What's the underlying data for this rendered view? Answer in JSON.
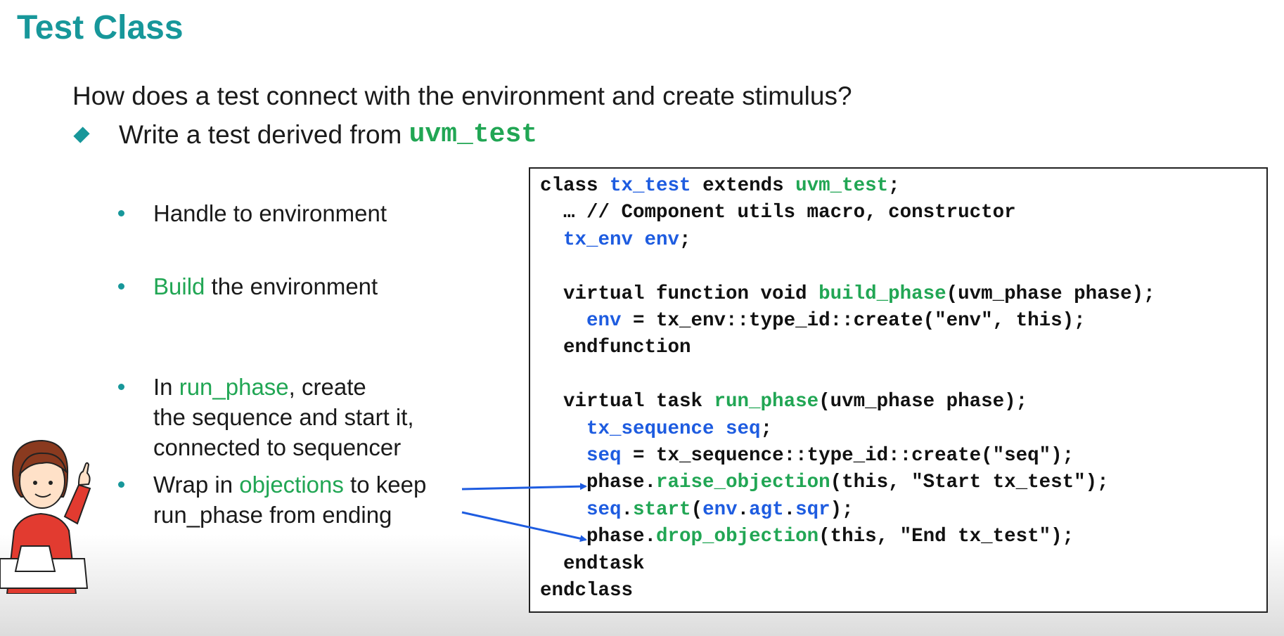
{
  "slide": {
    "title": "Test Class",
    "question": "How does a test connect with the environment and create stimulus?",
    "main_bullet": {
      "text": "Write a test derived from ",
      "code": "uvm_test"
    },
    "sub_bullets": [
      {
        "plain": "Handle to environment"
      },
      {
        "green": "Build",
        "rest": " the environment"
      },
      {
        "pre": "In ",
        "green": "run_phase",
        "rest": ", create",
        "line2": "the sequence and start it,",
        "line3": "connected to sequencer"
      },
      {
        "pre": "Wrap in ",
        "green": "objections",
        "rest": " to keep",
        "line2": "run_phase from ending"
      }
    ]
  },
  "code": {
    "l1": {
      "a": "class ",
      "b": "tx_test",
      "c": " extends ",
      "d": "uvm_test",
      "e": ";"
    },
    "l2": "  … // Component utils macro, constructor",
    "l3": {
      "a": "tx_env env",
      "b": ";"
    },
    "l5": {
      "a": "  virtual function void ",
      "b": "build_phase",
      "c": "(uvm_phase phase);"
    },
    "l6": {
      "a": "env",
      "b": " = tx_env::type_id::create(\"env\", this);"
    },
    "l7": "  endfunction",
    "l9": {
      "a": "  virtual task ",
      "b": "run_phase",
      "c": "(uvm_phase phase);"
    },
    "l10": {
      "a": "tx_sequence seq",
      "b": ";"
    },
    "l11": {
      "a": "seq",
      "b": " = tx_sequence::type_id::create(\"seq\");"
    },
    "l12": {
      "a": "phase.",
      "b": "raise_objection",
      "c": "(this, \"Start tx_test\");"
    },
    "l13": {
      "a": "seq",
      "b": ".",
      "c": "start",
      "d": "(",
      "e": "env",
      "f": ".",
      "g": "agt",
      "h": ".",
      "i": "sqr",
      "j": ");"
    },
    "l14": {
      "a": "phase.",
      "b": "drop_objection",
      "c": "(this, \"End tx_test\");"
    },
    "l15": "  endtask",
    "l16": "endclass"
  },
  "colors": {
    "title": "#17979a",
    "keyword_green": "#21a654",
    "identifier_blue": "#1e5ce0",
    "arrow": "#1e5ce0"
  },
  "icons": [
    "diamond-bullet-icon",
    "round-bullet-icon",
    "arrow-icon",
    "student-raising-hand-illustration"
  ]
}
